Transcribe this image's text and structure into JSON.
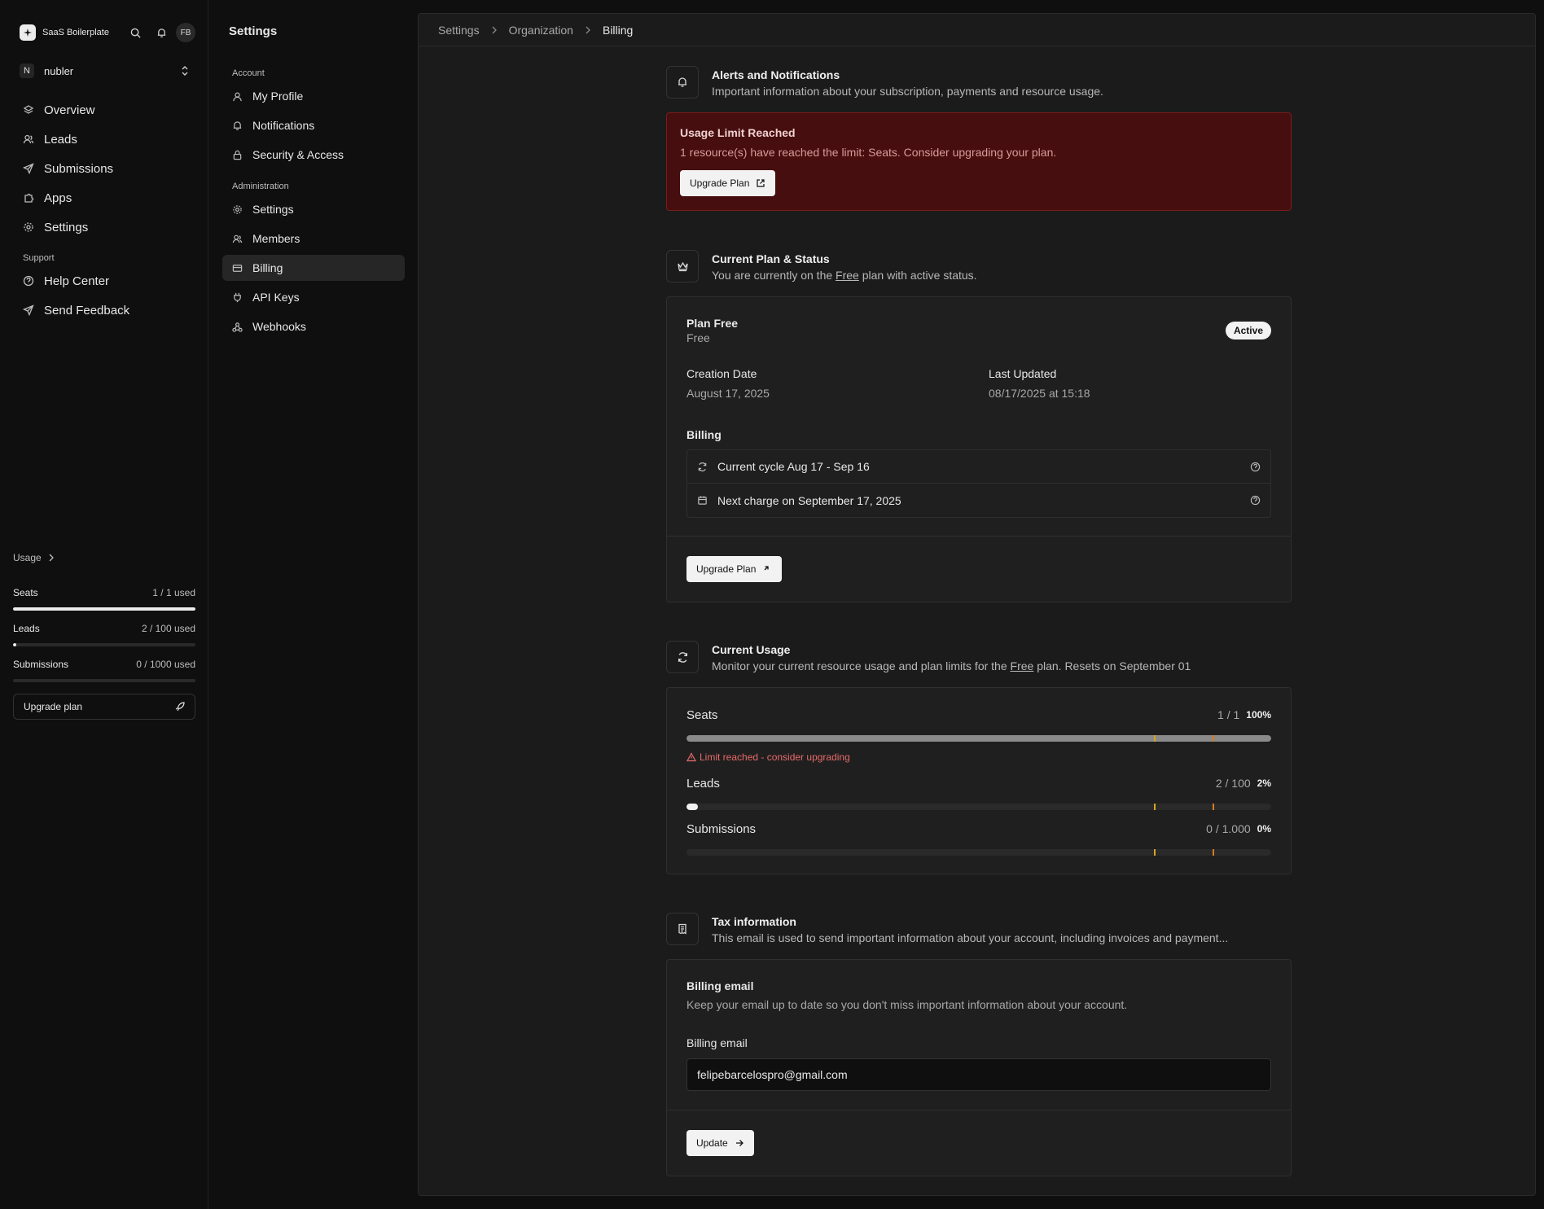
{
  "app": {
    "brand": "SaaS Boilerplate",
    "avatar_initials": "FB"
  },
  "org": {
    "badge": "N",
    "name": "nubler"
  },
  "nav": {
    "items": [
      {
        "label": "Overview",
        "icon": "layers-icon"
      },
      {
        "label": "Leads",
        "icon": "users-icon"
      },
      {
        "label": "Submissions",
        "icon": "send-icon"
      },
      {
        "label": "Apps",
        "icon": "puzzle-icon"
      },
      {
        "label": "Settings",
        "icon": "gear-icon"
      }
    ],
    "support_label": "Support",
    "support_items": [
      {
        "label": "Help Center",
        "icon": "help-circle-icon"
      },
      {
        "label": "Send Feedback",
        "icon": "send-icon"
      }
    ]
  },
  "usage": {
    "heading": "Usage",
    "items": [
      {
        "label": "Seats",
        "value": "1 / 1 used",
        "fraction": 1.0
      },
      {
        "label": "Leads",
        "value": "2 / 100 used",
        "fraction": 0.02
      },
      {
        "label": "Submissions",
        "value": "0 / 1000 used",
        "fraction": 0.0
      }
    ],
    "upgrade_label": "Upgrade plan"
  },
  "settings_nav": {
    "title": "Settings",
    "account_label": "Account",
    "account_items": [
      {
        "label": "My Profile",
        "icon": "user-icon"
      },
      {
        "label": "Notifications",
        "icon": "bell-icon"
      },
      {
        "label": "Security & Access",
        "icon": "lock-icon"
      }
    ],
    "admin_label": "Administration",
    "admin_items": [
      {
        "label": "Settings",
        "icon": "gear-icon"
      },
      {
        "label": "Members",
        "icon": "users-icon"
      },
      {
        "label": "Billing",
        "icon": "credit-card-icon",
        "active": true
      },
      {
        "label": "API Keys",
        "icon": "plug-icon"
      },
      {
        "label": "Webhooks",
        "icon": "webhook-icon"
      }
    ]
  },
  "breadcrumb": [
    "Settings",
    "Organization",
    "Billing"
  ],
  "alerts": {
    "title": "Alerts and Notifications",
    "subtitle": "Important information about your subscription, payments and resource usage.",
    "alert_title": "Usage Limit Reached",
    "alert_message": "1 resource(s) have reached the limit: Seats. Consider upgrading your plan.",
    "alert_button": "Upgrade Plan"
  },
  "plan": {
    "title": "Current Plan & Status",
    "subtitle_pre": "You are currently on the ",
    "subtitle_link": "Free",
    "subtitle_post": " plan with active status.",
    "plan_name": "Plan Free",
    "plan_tier": "Free",
    "status": "Active",
    "creation_label": "Creation Date",
    "creation_value": "August 17, 2025",
    "updated_label": "Last Updated",
    "updated_value": "08/17/2025 at 15:18",
    "billing_label": "Billing",
    "cycle": "Current cycle Aug 17 - Sep 16",
    "next_charge": "Next charge on September 17, 2025",
    "upgrade_button": "Upgrade Plan"
  },
  "current_usage": {
    "title": "Current Usage",
    "subtitle_pre": "Monitor your current resource usage and plan limits for the ",
    "subtitle_link": "Free",
    "subtitle_post": " plan. Resets on September 01",
    "items": [
      {
        "label": "Seats",
        "count": "1 / 1",
        "percent": "100%",
        "fraction": 1.0
      },
      {
        "label": "Leads",
        "count": "2 / 100",
        "percent": "2%",
        "fraction": 0.02
      },
      {
        "label": "Submissions",
        "count": "0 / 1.000",
        "percent": "0%",
        "fraction": 0.0
      }
    ],
    "limit_warning": "Limit reached - consider upgrading",
    "threshold_colors": [
      "#d9a520",
      "#d97a20"
    ]
  },
  "tax": {
    "title": "Tax information",
    "subtitle": "This email is used to send important information about your account, including invoices and payment...",
    "card_title": "Billing email",
    "card_desc": "Keep your email up to date so you don't miss important information about your account.",
    "field_label": "Billing email",
    "field_value": "felipebarcelospro@gmail.com",
    "update_button": "Update"
  },
  "colors": {
    "alert_bg": "#460e0e",
    "alert_border": "#7a1c1c",
    "warning_text": "#e86a6a"
  }
}
